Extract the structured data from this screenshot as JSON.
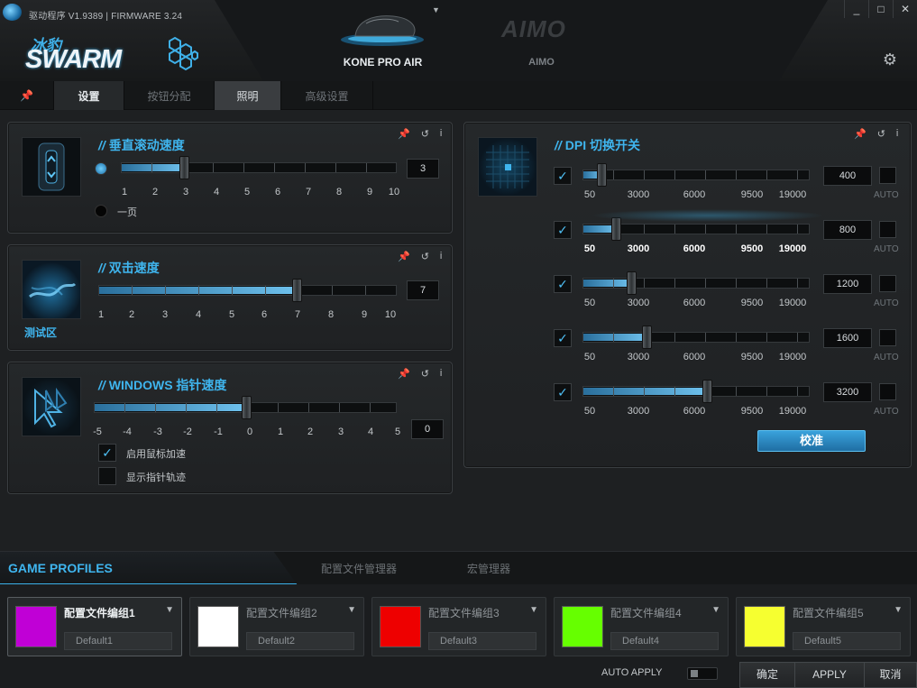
{
  "header": {
    "version": "驱动程序 V1.9389 | FIRMWARE 3.24",
    "logo_cn": "冰豹",
    "logo_en": "SWARM",
    "devices": [
      {
        "label": "KONE PRO AIR"
      },
      {
        "label": "AIMO",
        "logo": "AIMO"
      }
    ],
    "window_controls": [
      "_",
      "□",
      "✕"
    ]
  },
  "tabs": [
    "设置",
    "按钮分配",
    "照明",
    "高级设置"
  ],
  "scroll_panel": {
    "title": "垂直滚动速度",
    "scale": [
      "1",
      "2",
      "3",
      "4",
      "5",
      "6",
      "7",
      "8",
      "9",
      "10"
    ],
    "value": "3",
    "page_label": "一页"
  },
  "dblclick_panel": {
    "title": "双击速度",
    "scale": [
      "1",
      "2",
      "3",
      "4",
      "5",
      "6",
      "7",
      "8",
      "9",
      "10"
    ],
    "value": "7",
    "test_label": "测试区"
  },
  "pointer_panel": {
    "title": "WINDOWS 指针速度",
    "scale": [
      "-5",
      "-4",
      "-3",
      "-2",
      "-1",
      "0",
      "1",
      "2",
      "3",
      "4",
      "5"
    ],
    "value": "0",
    "accel_label": "启用鼠标加速",
    "trail_label": "显示指针轨迹"
  },
  "dpi_panel": {
    "title": "DPI 切换开关",
    "scale": [
      "50",
      "3000",
      "6000",
      "9500",
      "19000"
    ],
    "auto_label": "AUTO",
    "levels": [
      {
        "value": "400",
        "level": 400
      },
      {
        "value": "800",
        "level": 800
      },
      {
        "value": "1200",
        "level": 1200
      },
      {
        "value": "1600",
        "level": 1600
      },
      {
        "value": "3200",
        "level": 3200
      }
    ],
    "calibrate_label": "校准"
  },
  "profiles": {
    "title": "GAME PROFILES",
    "tabs": [
      "配置文件管理器",
      "宏管理器"
    ],
    "slots": [
      {
        "name": "配置文件编组1",
        "default": "Default1",
        "color": "#c000d6"
      },
      {
        "name": "配置文件编组2",
        "default": "Default2",
        "color": "#ffffff"
      },
      {
        "name": "配置文件编组3",
        "default": "Default3",
        "color": "#ee0000"
      },
      {
        "name": "配置文件编组4",
        "default": "Default4",
        "color": "#66ff00"
      },
      {
        "name": "配置文件编组5",
        "default": "Default5",
        "color": "#f6ff30"
      }
    ]
  },
  "footer": {
    "auto_apply": "AUTO APPLY",
    "ok": "确定",
    "apply": "APPLY",
    "cancel": "取消"
  },
  "colors": {
    "accent": "#3fb5ee",
    "background": "#1e2022"
  }
}
